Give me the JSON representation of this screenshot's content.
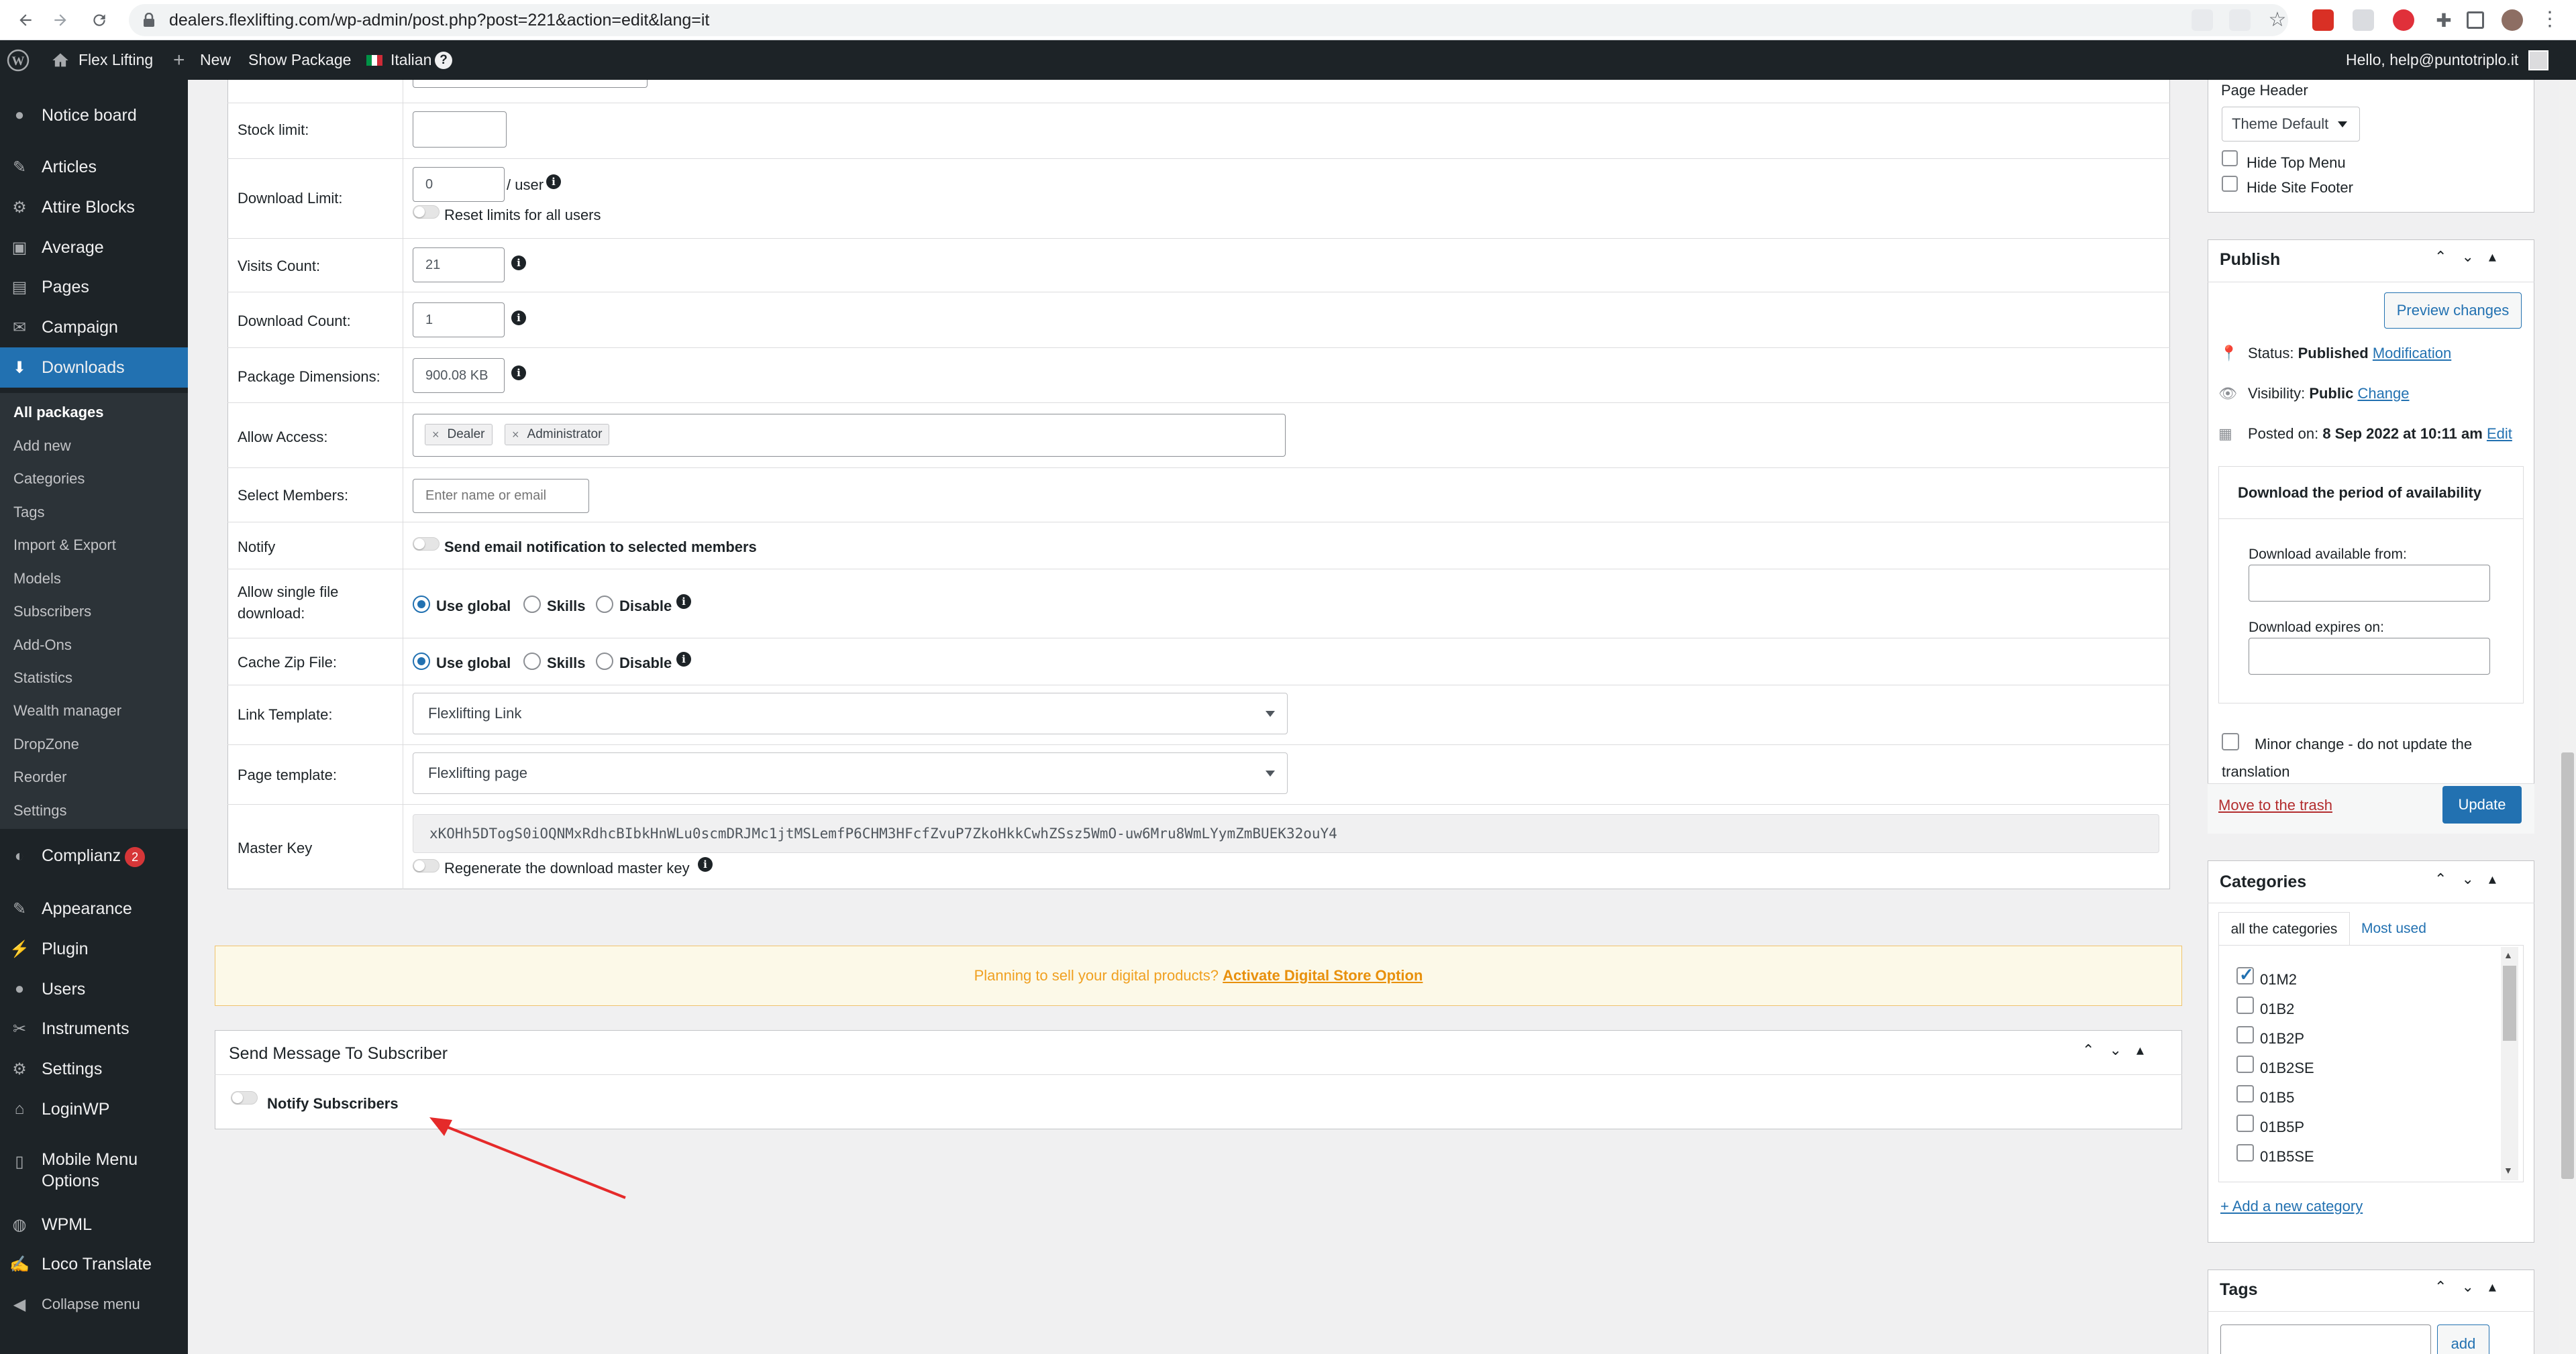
{
  "browser": {
    "url": "dealers.flexlifting.com/wp-admin/post.php?post=221&action=edit&lang=it"
  },
  "adminbar": {
    "site_name": "Flex Lifting",
    "new_label": "New",
    "show_package": "Show Package",
    "language": "Italian",
    "greeting": "Hello, help@puntotriplo.it"
  },
  "sidebar": {
    "items": [
      {
        "label": "Notice board",
        "icon": "notice-icon"
      },
      {
        "label": "Articles",
        "icon": "pin-icon"
      },
      {
        "label": "Attire Blocks",
        "icon": "blocks-icon"
      },
      {
        "label": "Average",
        "icon": "media-icon"
      },
      {
        "label": "Pages",
        "icon": "pages-icon"
      },
      {
        "label": "Campaign",
        "icon": "mail-icon"
      },
      {
        "label": "Downloads",
        "icon": "download-icon"
      }
    ],
    "submenu": [
      "All packages",
      "Add new",
      "Categories",
      "Tags",
      "Import & Export",
      "Models",
      "Subscribers",
      "Add-Ons",
      "Statistics",
      "Wealth manager",
      "DropZone",
      "Reorder",
      "Settings"
    ],
    "lower_items": [
      {
        "label": "Complianz",
        "badge": "2"
      },
      {
        "label": "Appearance"
      },
      {
        "label": "Plugin"
      },
      {
        "label": "Users"
      },
      {
        "label": "Instruments"
      },
      {
        "label": "Settings"
      },
      {
        "label": "LoginWP"
      },
      {
        "label": "Mobile Menu"
      },
      {
        "label": "WPML"
      },
      {
        "label": "Loco Translate"
      },
      {
        "label": "Collapse menu"
      }
    ],
    "mobile_menu_line2": "Options"
  },
  "form": {
    "stock_limit_label": "Stock limit:",
    "download_limit_label": "Download Limit:",
    "download_limit_value": "0",
    "per_user": "/ user",
    "reset_limits": "Reset limits for all users",
    "visits_label": "Visits Count:",
    "visits_value": "21",
    "download_count_label": "Download Count:",
    "download_count_value": "1",
    "package_dim_label": "Package Dimensions:",
    "package_dim_value": "900.08 KB",
    "allow_access_label": "Allow Access:",
    "access_roles": [
      "Dealer",
      "Administrator"
    ],
    "select_members_label": "Select Members:",
    "select_members_placeholder": "Enter name or email",
    "notify_label": "Notify",
    "notify_text": "Send email notification to selected members",
    "single_file_label_1": "Allow single file",
    "single_file_label_2": "download:",
    "opt_global": "Use global",
    "opt_skills": "Skills",
    "opt_disable": "Disable",
    "cache_zip_label": "Cache Zip File:",
    "link_template_label": "Link Template:",
    "link_template_value": "Flexlifting Link",
    "page_template_label": "Page template:",
    "page_template_value": "Flexlifting page",
    "master_key_label": "Master Key",
    "master_key_value": "xKOHh5DTogS0iOQNMxRdhcBIbkHnWLu0scmDRJMc1jtMSLemfP6CHM3HFcfZvuP7ZkoHkkCwhZSsz5WmO-uw6Mru8WmLYymZmBUEK32ouY4",
    "regenerate_key": "Regenerate the download master key"
  },
  "notice": {
    "text": "Planning to sell your digital products?",
    "link": "Activate Digital Store Option"
  },
  "subscriber_box": {
    "title": "Send Message To Subscriber",
    "toggle_label": "Notify Subscribers"
  },
  "page_header_box": {
    "title": "Page Header",
    "select_value": "Theme Default",
    "hide_top_menu": "Hide Top Menu",
    "hide_site_footer": "Hide Site Footer"
  },
  "publish": {
    "title": "Publish",
    "preview": "Preview changes",
    "status_label": "Status:",
    "status_value": "Published",
    "status_link": "Modification",
    "visibility_label": "Visibility:",
    "visibility_value": "Public",
    "visibility_link": "Change",
    "posted_label": "Posted on:",
    "posted_value": "8 Sep 2022 at 10:11 am",
    "posted_link": "Edit",
    "period_title": "Download the period of availability",
    "available_from": "Download available from:",
    "expires_on": "Download expires on:",
    "minor_change_1": "Minor change - do not update the",
    "minor_change_2": "translation",
    "trash": "Move to the trash",
    "update": "Update"
  },
  "categories": {
    "title": "Categories",
    "tab_all": "all the categories",
    "tab_used": "Most used",
    "items": [
      {
        "label": "01M2",
        "checked": true
      },
      {
        "label": "01B2",
        "checked": false
      },
      {
        "label": "01B2P",
        "checked": false
      },
      {
        "label": "01B2SE",
        "checked": false
      },
      {
        "label": "01B5",
        "checked": false
      },
      {
        "label": "01B5P",
        "checked": false
      },
      {
        "label": "01B5SE",
        "checked": false
      }
    ],
    "add_new": "+ Add a new category"
  },
  "tags": {
    "title": "Tags",
    "add": "add"
  },
  "colors": {
    "wp_dark": "#1d2327",
    "wp_blue": "#2271b1",
    "notice_orange": "#f0a020",
    "annotation_red": "#e52a2a"
  }
}
